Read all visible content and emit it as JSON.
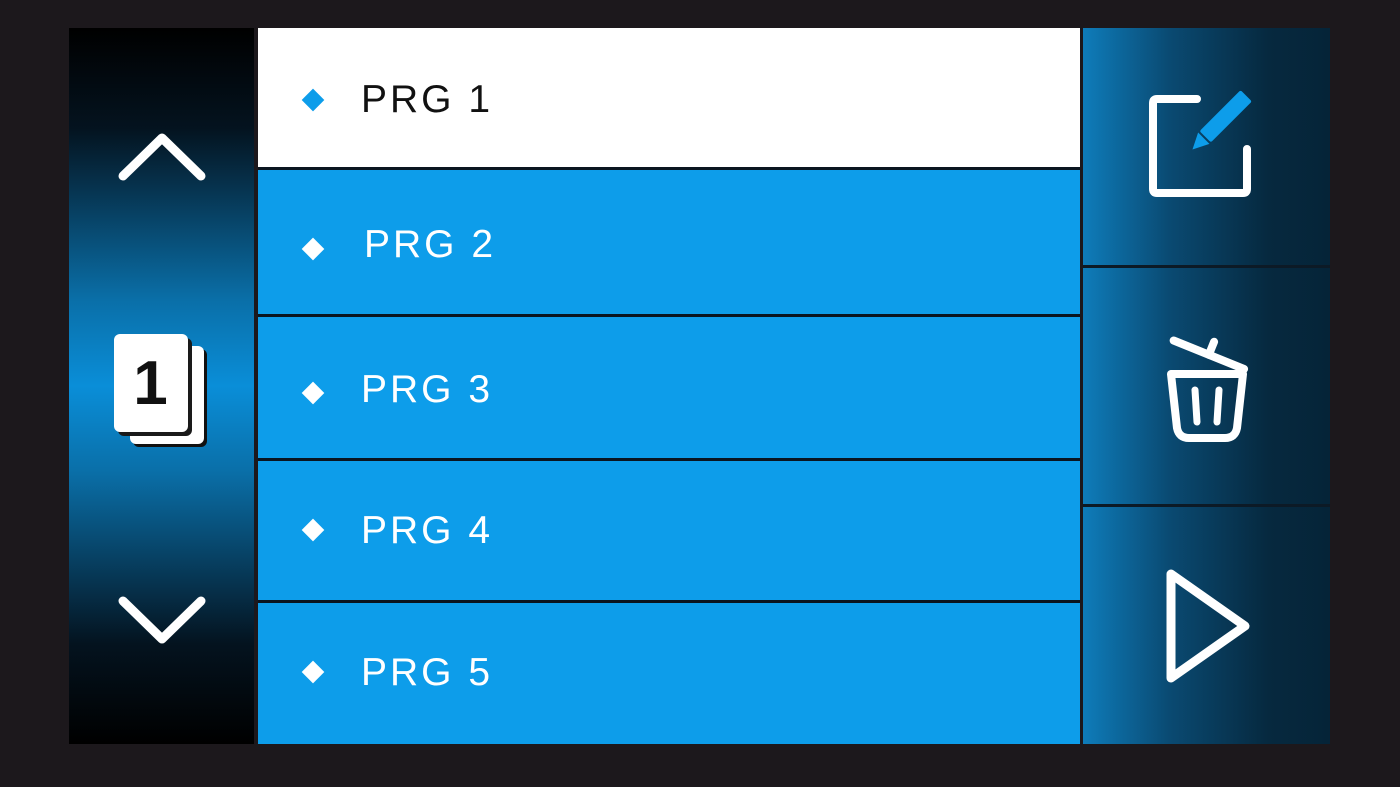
{
  "nav": {
    "up_icon": "chevron-up-icon",
    "down_icon": "chevron-down-icon",
    "page_number": "1"
  },
  "programs": [
    {
      "label": "PRG 1",
      "selected": true
    },
    {
      "label": "PRG 2",
      "selected": false
    },
    {
      "label": "PRG 3",
      "selected": false
    },
    {
      "label": "PRG 4",
      "selected": false
    },
    {
      "label": "PRG 5",
      "selected": false
    }
  ],
  "actions": {
    "edit_icon": "edit-icon",
    "delete_icon": "trash-icon",
    "run_icon": "play-icon"
  },
  "colors": {
    "background": "#1c181c",
    "accent": "#0d9dea",
    "selected_row": "#ffffff"
  }
}
